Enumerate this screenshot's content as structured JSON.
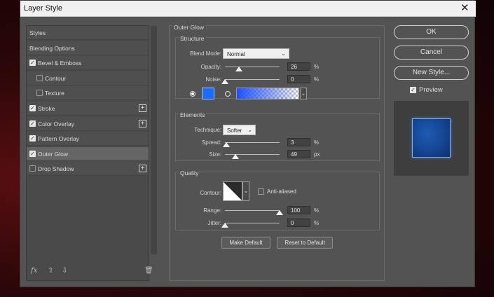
{
  "window": {
    "title": "Layer Style",
    "close_glyph": "✕"
  },
  "left_panel": {
    "items": [
      {
        "label": "Styles",
        "checkbox": "none",
        "selected": false,
        "plus": false,
        "indent": 0
      },
      {
        "label": "Blending Options",
        "checkbox": "none",
        "selected": false,
        "plus": false,
        "indent": 0
      },
      {
        "label": "Bevel & Emboss",
        "checkbox": "checked",
        "selected": false,
        "plus": false,
        "indent": 0
      },
      {
        "label": "Contour",
        "checkbox": "unchecked",
        "selected": false,
        "plus": false,
        "indent": 1
      },
      {
        "label": "Texture",
        "checkbox": "unchecked",
        "selected": false,
        "plus": false,
        "indent": 1
      },
      {
        "label": "Stroke",
        "checkbox": "checked",
        "selected": false,
        "plus": true,
        "indent": 0
      },
      {
        "label": "Color Overlay",
        "checkbox": "checked",
        "selected": false,
        "plus": true,
        "indent": 0
      },
      {
        "label": "Pattern Overlay",
        "checkbox": "checked",
        "selected": false,
        "plus": false,
        "indent": 0
      },
      {
        "label": "Outer Glow",
        "checkbox": "checked",
        "selected": true,
        "plus": false,
        "indent": 0
      },
      {
        "label": "Drop Shadow",
        "checkbox": "unchecked",
        "selected": false,
        "plus": true,
        "indent": 0
      }
    ],
    "bottom_icons": {
      "fx": "fx",
      "up": "⇧",
      "down": "⇩",
      "trash": "🗑"
    }
  },
  "outer_glow": {
    "title": "Outer Glow",
    "structure": {
      "header": "Structure",
      "blend_mode_label": "Blend Mode:",
      "blend_mode_value": "Normal",
      "opacity_label": "Opacity:",
      "opacity_value": "26",
      "opacity_level": 26,
      "noise_label": "Noise:",
      "noise_value": "0",
      "noise_level": 0,
      "percent": "%",
      "glow_color": "#1a6cff"
    },
    "elements": {
      "header": "Elements",
      "technique_label": "Technique:",
      "technique_value": "Softer",
      "spread_label": "Spread:",
      "spread_value": "3",
      "spread_level": 3,
      "size_label": "Size:",
      "size_value": "49",
      "size_level": 19.6,
      "percent": "%",
      "px": "px"
    },
    "quality": {
      "header": "Quality",
      "contour_label": "Contour:",
      "anti_aliased_label": "Anti-aliased",
      "range_label": "Range:",
      "range_value": "100",
      "range_level": 100,
      "jitter_label": "Jitter:",
      "jitter_value": "0",
      "jitter_level": 0,
      "percent": "%"
    },
    "make_default": "Make Default",
    "reset_to_default": "Reset to Default"
  },
  "right_panel": {
    "ok": "OK",
    "cancel": "Cancel",
    "new_style": "New Style...",
    "preview_label": "Preview",
    "preview_checked": true
  }
}
